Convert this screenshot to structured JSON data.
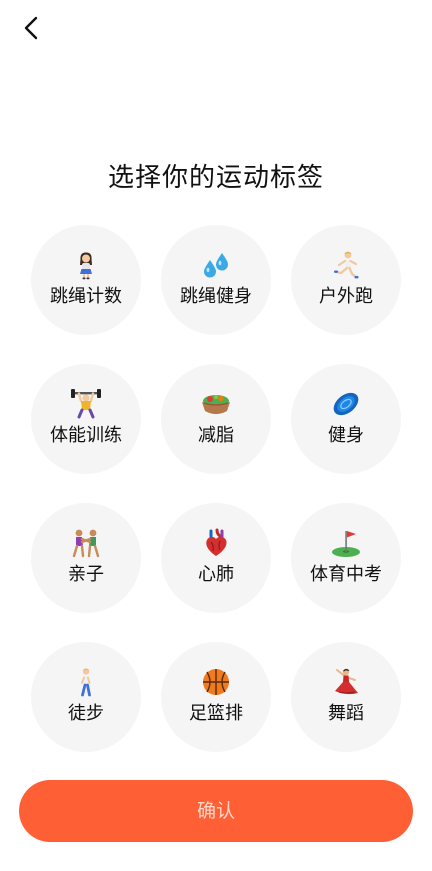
{
  "page": {
    "title": "选择你的运动标签",
    "back_icon": "chevron-left-icon",
    "confirm_label": "确认"
  },
  "colors": {
    "accent": "#ff5f35",
    "confirm_text": "#ffd9cc",
    "tag_background": "#f5f5f5"
  },
  "tags": [
    {
      "label": "跳绳计数",
      "icon": "girl-standing-icon"
    },
    {
      "label": "跳绳健身",
      "icon": "sweat-droplets-icon"
    },
    {
      "label": "户外跑",
      "icon": "runner-icon"
    },
    {
      "label": "体能训练",
      "icon": "weightlifter-icon"
    },
    {
      "label": "减脂",
      "icon": "salad-bowl-icon"
    },
    {
      "label": "健身",
      "icon": "frisbee-icon"
    },
    {
      "label": "亲子",
      "icon": "wrestlers-icon"
    },
    {
      "label": "心肺",
      "icon": "anatomical-heart-icon"
    },
    {
      "label": "体育中考",
      "icon": "golf-flag-icon"
    },
    {
      "label": "徒步",
      "icon": "walker-icon"
    },
    {
      "label": "足篮排",
      "icon": "basketball-icon"
    },
    {
      "label": "舞蹈",
      "icon": "dancer-icon"
    }
  ]
}
